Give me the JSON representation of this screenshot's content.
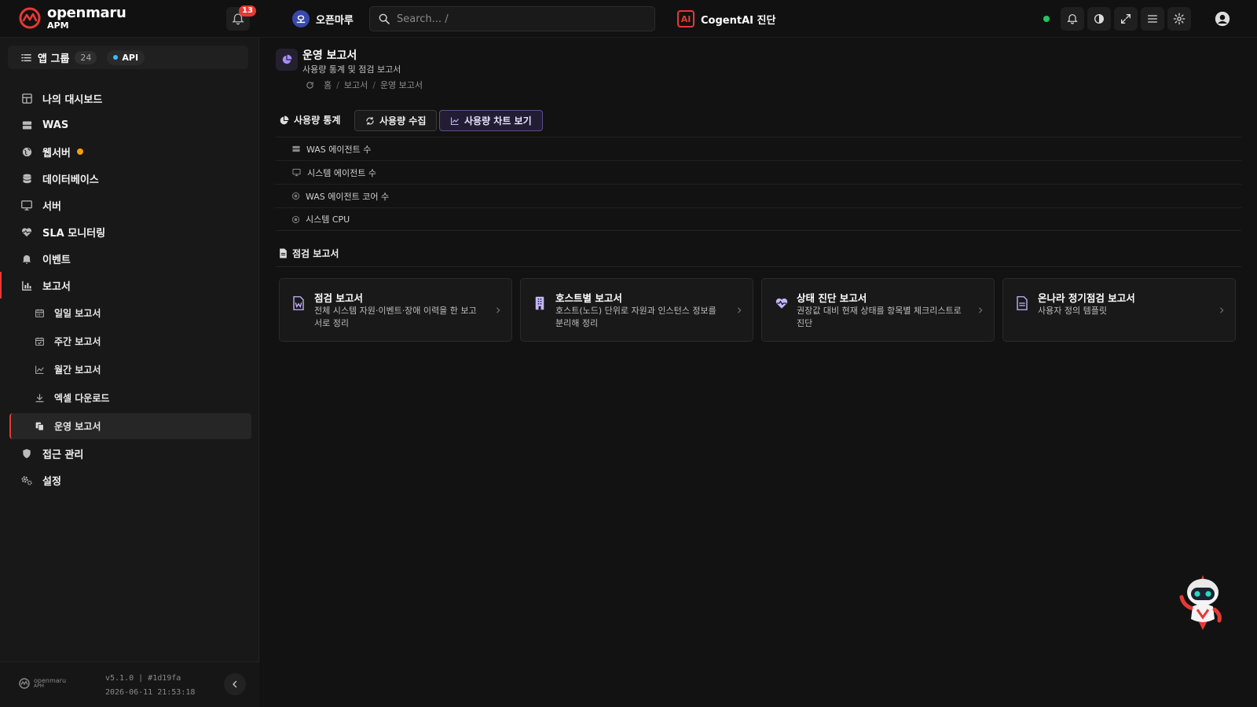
{
  "header": {
    "logo_name": "openmaru",
    "logo_sub": "APM",
    "notification_count": "13",
    "org_avatar": "오",
    "org_name": "오픈마루",
    "search_placeholder": "Search... /",
    "cogent_badge": "AI",
    "cogent_label": "CogentAI 진단"
  },
  "sidebar": {
    "app_group_label": "앱 그룹",
    "app_group_count": "24",
    "api_label": "API",
    "items": [
      {
        "label": "나의 대시보드",
        "icon": "dashboard-icon"
      },
      {
        "label": "WAS",
        "icon": "server-stack-icon"
      },
      {
        "label": "웹서버",
        "icon": "globe-icon"
      },
      {
        "label": "데이터베이스",
        "icon": "database-icon"
      },
      {
        "label": "서버",
        "icon": "monitor-icon"
      },
      {
        "label": "SLA 모니터링",
        "icon": "heartbeat-icon"
      },
      {
        "label": "이벤트",
        "icon": "bell-icon"
      },
      {
        "label": "보고서",
        "icon": "bar-chart-icon"
      }
    ],
    "report_sub": [
      {
        "label": "일일 보고서",
        "icon": "calendar-icon"
      },
      {
        "label": "주간 보고서",
        "icon": "calendar-check-icon"
      },
      {
        "label": "월간 보고서",
        "icon": "line-chart-icon"
      },
      {
        "label": "엑셀 다운로드",
        "icon": "download-icon"
      },
      {
        "label": "운영 보고서",
        "icon": "copy-icon"
      }
    ],
    "bottom_items": [
      {
        "label": "접근 관리",
        "icon": "shield-icon"
      },
      {
        "label": "설정",
        "icon": "cogs-icon"
      }
    ],
    "footer": {
      "logo_name": "openmaru",
      "logo_sub": "APM",
      "version": "v5.1.0 | #1d19fa",
      "timestamp": "2026-06-11 21:53:18"
    }
  },
  "page": {
    "title": "운영 보고서",
    "subtitle": "사용량 통계 및 점검 보고서",
    "breadcrumb": [
      "홈",
      "보고서",
      "운영 보고서"
    ],
    "usage_section": "사용량 통계",
    "collect_button": "사용량 수집",
    "chart_button": "사용량 차트 보기",
    "usage_rows": [
      {
        "label": "WAS 에이전트 수",
        "icon": "server-icon"
      },
      {
        "label": "시스템 에이전트 수",
        "icon": "monitor-icon"
      },
      {
        "label": "WAS 에이전트 코어 수",
        "icon": "chip-icon"
      },
      {
        "label": "시스템 CPU",
        "icon": "chip-icon"
      }
    ],
    "inspect_section": "점검 보고서",
    "cards": [
      {
        "title": "점검 보고서",
        "desc": "전체 시스템 자원·이벤트·장애 이력을 한 보고서로 정리",
        "icon": "word-file-icon"
      },
      {
        "title": "호스트별 보고서",
        "desc": "호스트(노드) 단위로 자원과 인스턴스 정보를 분리해 정리",
        "icon": "building-icon"
      },
      {
        "title": "상태 진단 보고서",
        "desc": "권장값 대비 현재 상태를 항목별 체크리스트로 진단",
        "icon": "heart-pulse-icon"
      },
      {
        "title": "온나라 정기점검 보고서",
        "desc": "사용자 정의 템플릿",
        "icon": "document-icon"
      }
    ]
  },
  "colors": {
    "accent": "#e53935",
    "purple": "#a78bfa",
    "status_green": "#22c55e",
    "warning": "#f59e0b"
  }
}
